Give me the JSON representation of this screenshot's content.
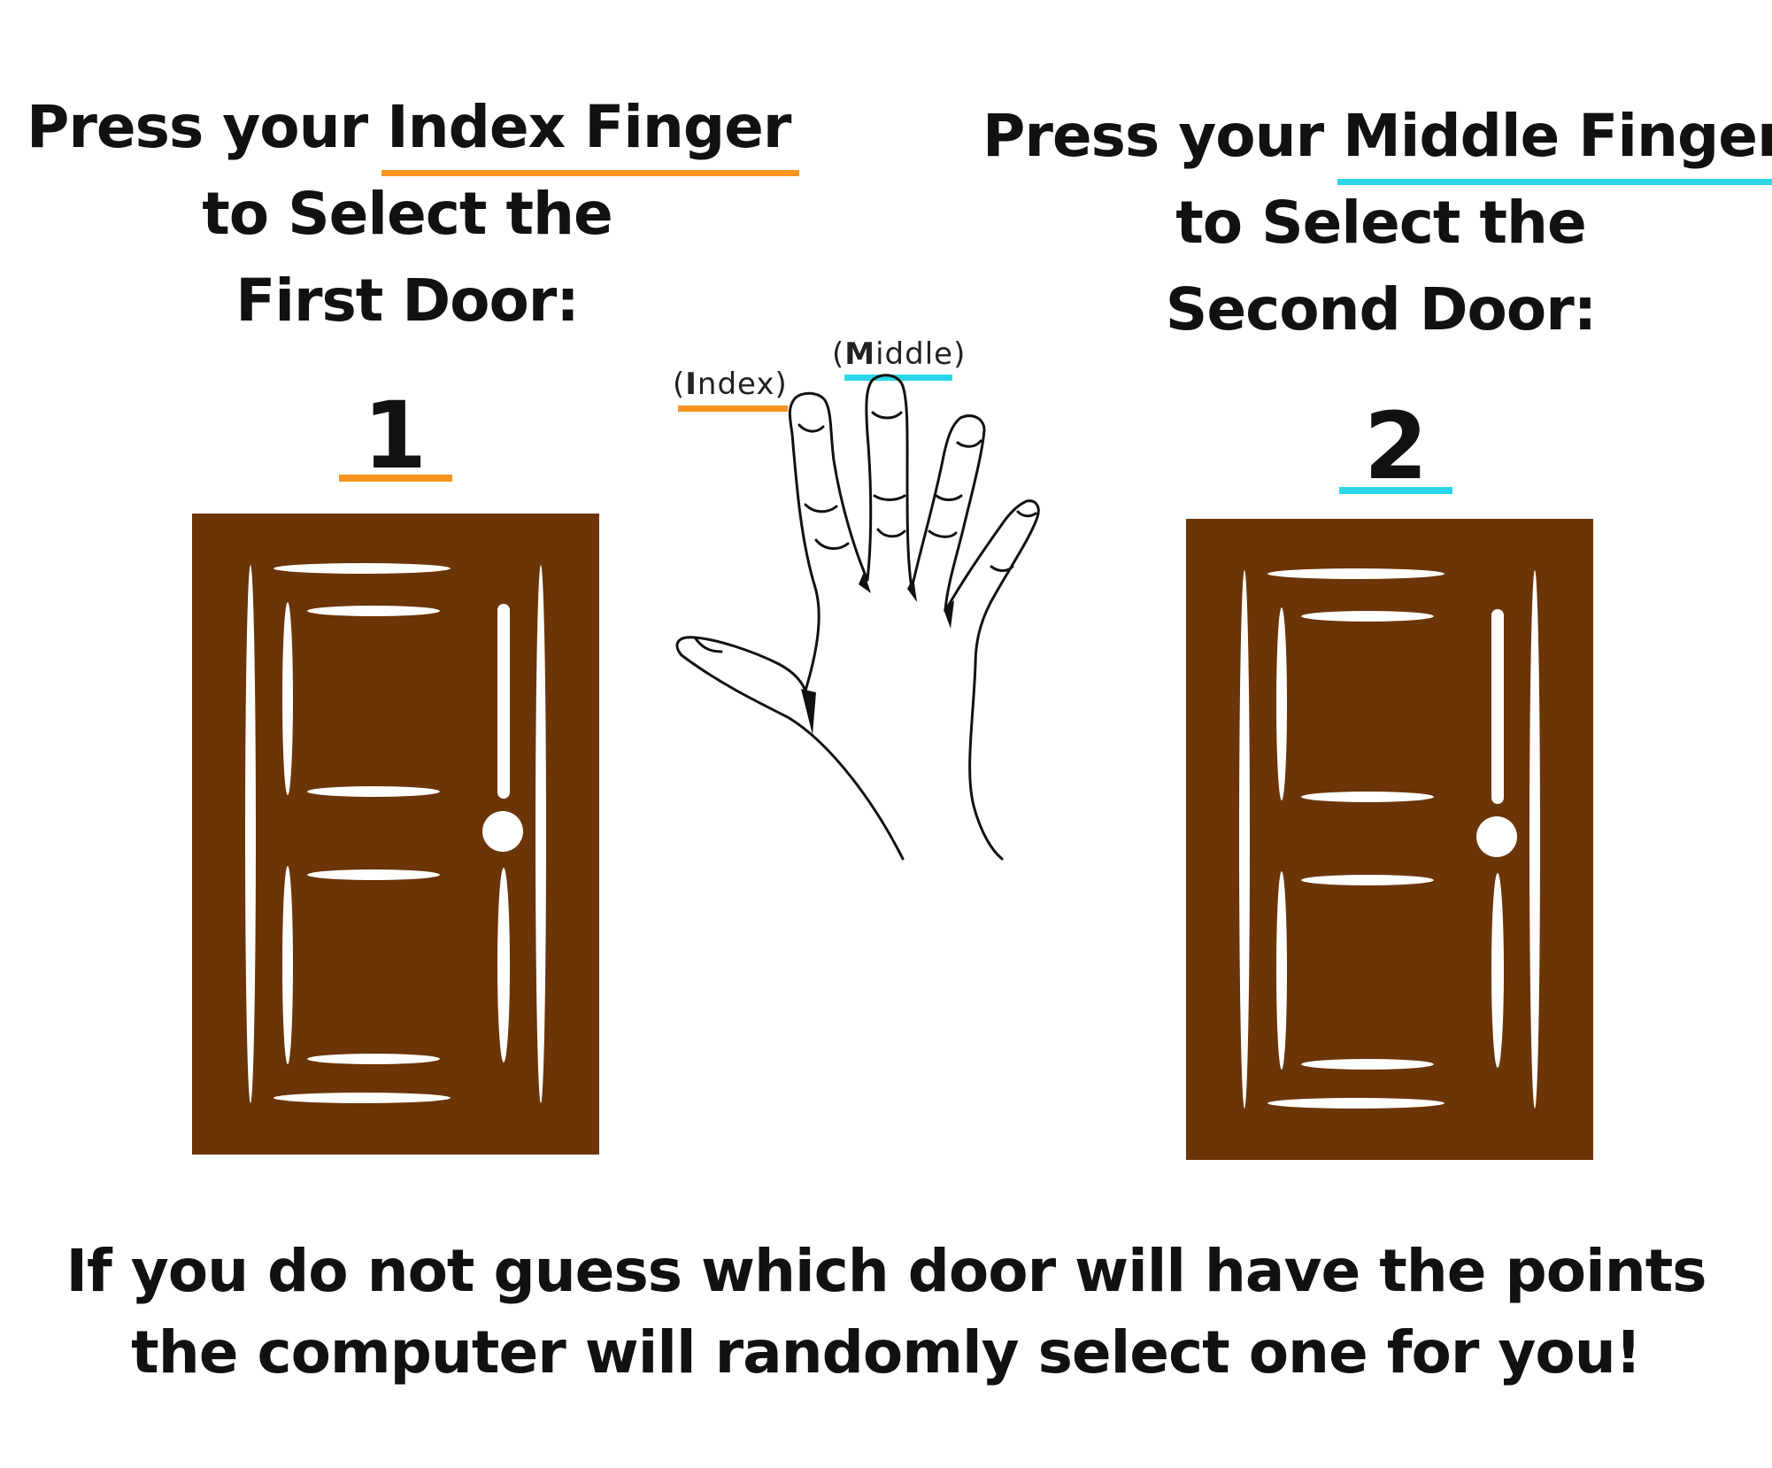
{
  "left_instruction": {
    "line1_prefix": "Press your ",
    "line1_highlight": "Index Finger",
    "line2": "to Select the",
    "line3": "First Door:",
    "underline_color": "#f7941d"
  },
  "right_instruction": {
    "line1_prefix": "Press your ",
    "line1_highlight": "Middle Finger",
    "line2": "to Select the",
    "line3": "Second Door:",
    "underline_color": "#29d8e8"
  },
  "door1": {
    "number": "1",
    "underline_color": "#f7941d",
    "color": "#6b3507"
  },
  "door2": {
    "number": "2",
    "underline_color": "#29d8e8",
    "color": "#6b3507"
  },
  "hand": {
    "icon": "hand-icon",
    "index_label": {
      "open": "(",
      "initial": "I",
      "rest": "ndex",
      "close": ")",
      "underline_color": "#f7941d"
    },
    "middle_label": {
      "open": "(",
      "initial": "M",
      "rest": "iddle",
      "close": ")",
      "underline_color": "#29d8e8"
    }
  },
  "note": {
    "line1": "If you do not guess which door will have the points",
    "line2": "the computer will randomly select one for you!"
  }
}
